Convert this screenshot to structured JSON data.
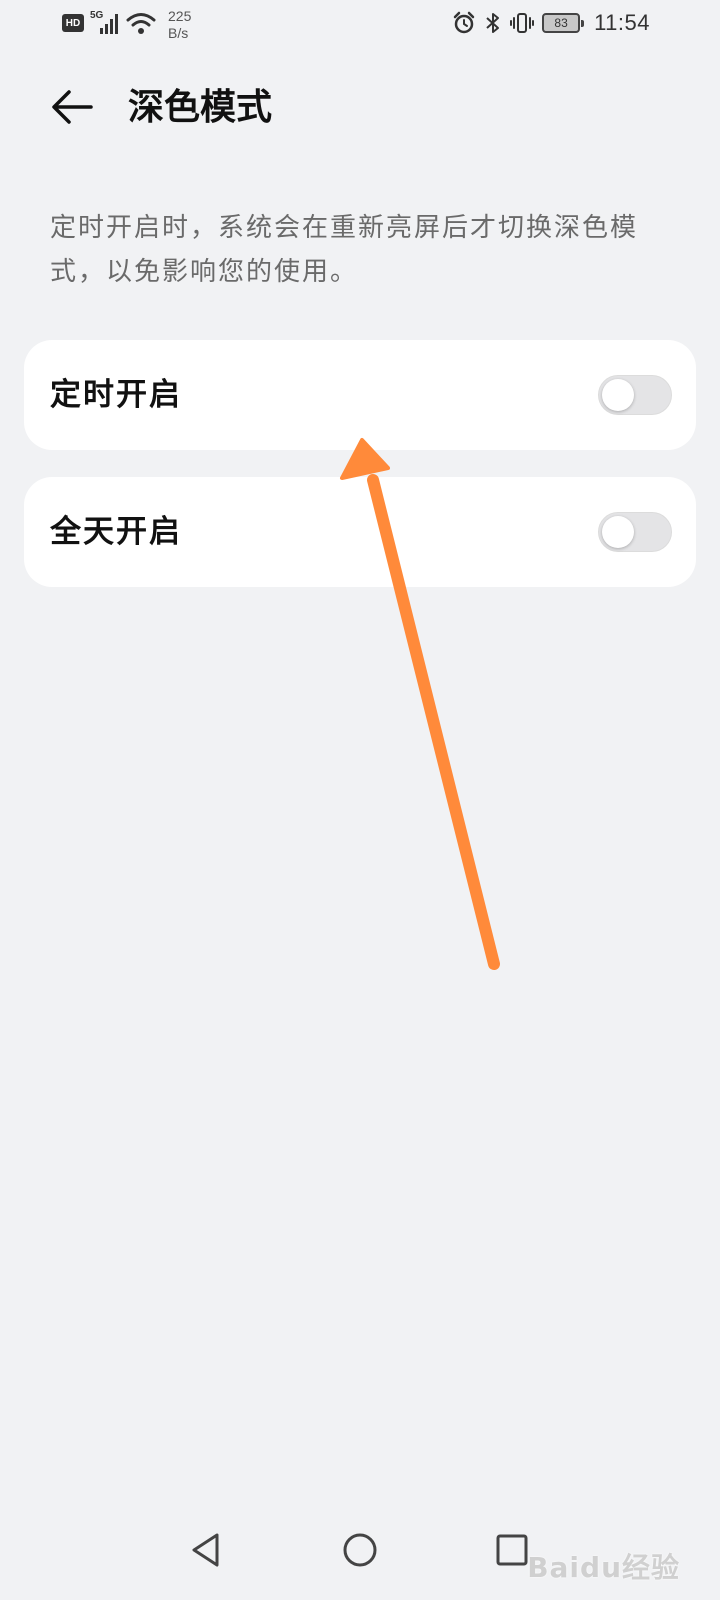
{
  "status_bar": {
    "hd_label": "HD",
    "signal_label": "5G",
    "net_speed_value": "225",
    "net_speed_unit": "B/s",
    "battery_level": "83",
    "time": "11:54"
  },
  "header": {
    "title": "深色模式"
  },
  "description": "定时开启时，系统会在重新亮屏后才切换深色模式，以免影响您的使用。",
  "settings": [
    {
      "label": "定时开启",
      "enabled": false
    },
    {
      "label": "全天开启",
      "enabled": false
    }
  ],
  "watermark": "Baidu经验",
  "colors": {
    "background": "#f1f2f4",
    "card": "#ffffff",
    "toggle_off": "#e4e4e6",
    "annotation_arrow": "#ff8a3a"
  }
}
